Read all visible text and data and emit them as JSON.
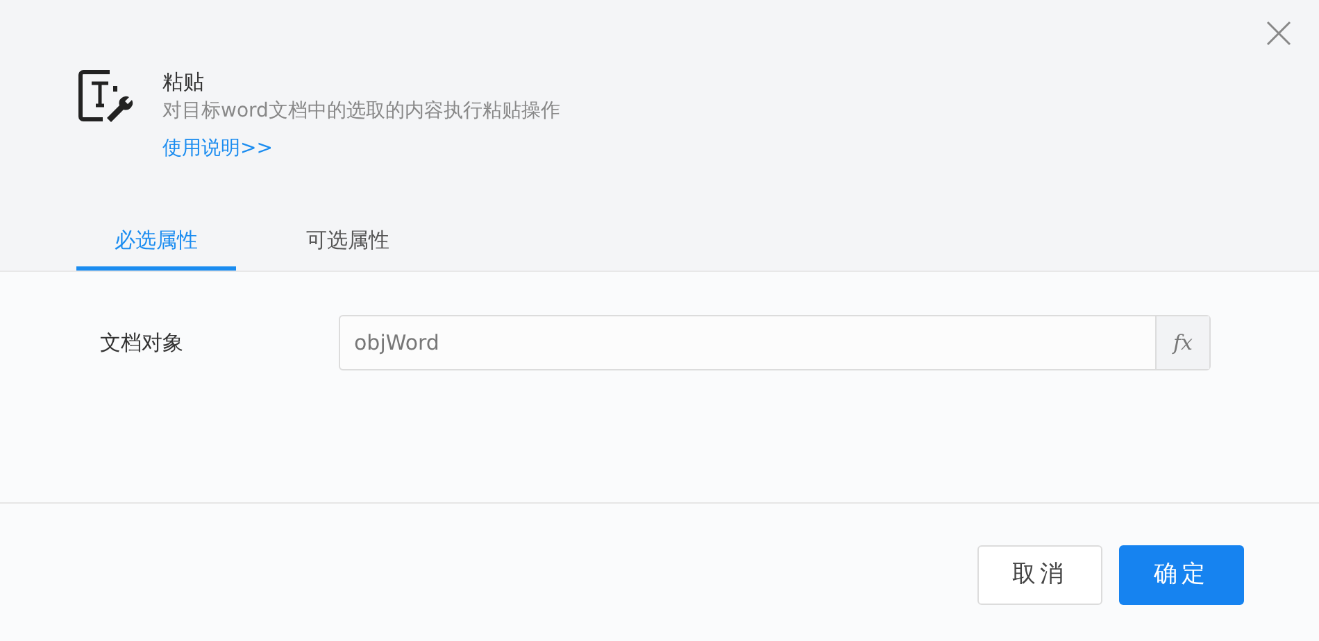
{
  "dialog": {
    "title": "粘贴",
    "description": "对目标word文档中的选取的内容执行粘贴操作",
    "help_link": "使用说明>>"
  },
  "tabs": [
    {
      "label": "必选属性",
      "selected": true
    },
    {
      "label": "可选属性",
      "selected": false
    }
  ],
  "fields": [
    {
      "label": "文档对象",
      "value": "objWord",
      "suffix": "fx"
    }
  ],
  "buttons": [
    {
      "label": "取消",
      "kind": "secondary"
    },
    {
      "label": "确定",
      "kind": "primary"
    }
  ]
}
